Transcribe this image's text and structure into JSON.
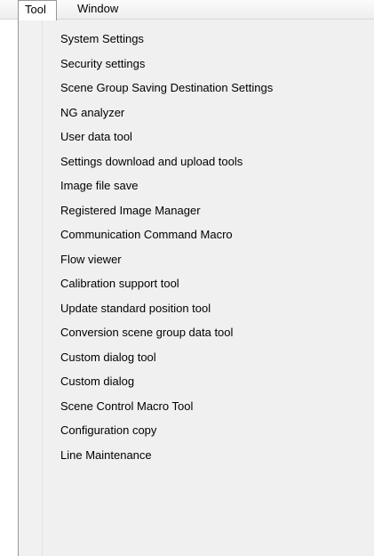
{
  "menubar": {
    "tool_label": "Tool",
    "window_label": "Window"
  },
  "tool_menu": {
    "items": [
      {
        "label": "System Settings"
      },
      {
        "label": "Security settings"
      },
      {
        "label": "Scene Group Saving Destination Settings"
      },
      {
        "label": "NG analyzer"
      },
      {
        "label": "User data tool"
      },
      {
        "label": "Settings download and upload tools"
      },
      {
        "label": "Image file save"
      },
      {
        "label": "Registered Image Manager"
      },
      {
        "label": "Communication Command Macro"
      },
      {
        "label": "Flow viewer"
      },
      {
        "label": "Calibration support tool"
      },
      {
        "label": "Update standard position tool"
      },
      {
        "label": "Conversion scene group data tool"
      },
      {
        "label": "Custom dialog tool"
      },
      {
        "label": "Custom dialog"
      },
      {
        "label": "Scene Control Macro Tool"
      },
      {
        "label": "Configuration copy"
      },
      {
        "label": "Line Maintenance"
      }
    ]
  }
}
